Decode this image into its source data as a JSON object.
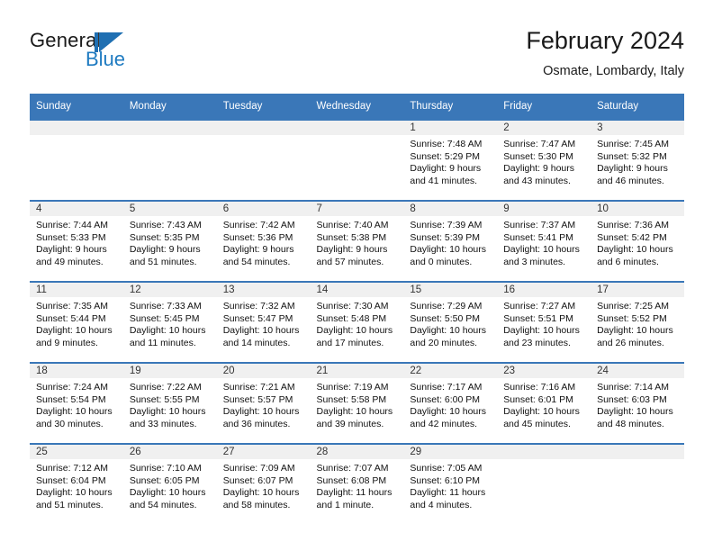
{
  "brand": {
    "name_part1": "General",
    "name_part2": "Blue",
    "mark_icon": "triangle-logo-icon"
  },
  "header": {
    "month_title": "February 2024",
    "location": "Osmate, Lombardy, Italy"
  },
  "theme": {
    "header_blue": "#3a77b8",
    "daynum_band": "#f0f0f0",
    "brand_blue": "#1f7bc1",
    "text": "#111111"
  },
  "weekday_headers": [
    "Sunday",
    "Monday",
    "Tuesday",
    "Wednesday",
    "Thursday",
    "Friday",
    "Saturday"
  ],
  "weeks": [
    [
      {
        "day": "",
        "lines": []
      },
      {
        "day": "",
        "lines": []
      },
      {
        "day": "",
        "lines": []
      },
      {
        "day": "",
        "lines": []
      },
      {
        "day": "1",
        "lines": [
          "Sunrise: 7:48 AM",
          "Sunset: 5:29 PM",
          "Daylight: 9 hours",
          "and 41 minutes."
        ]
      },
      {
        "day": "2",
        "lines": [
          "Sunrise: 7:47 AM",
          "Sunset: 5:30 PM",
          "Daylight: 9 hours",
          "and 43 minutes."
        ]
      },
      {
        "day": "3",
        "lines": [
          "Sunrise: 7:45 AM",
          "Sunset: 5:32 PM",
          "Daylight: 9 hours",
          "and 46 minutes."
        ]
      }
    ],
    [
      {
        "day": "4",
        "lines": [
          "Sunrise: 7:44 AM",
          "Sunset: 5:33 PM",
          "Daylight: 9 hours",
          "and 49 minutes."
        ]
      },
      {
        "day": "5",
        "lines": [
          "Sunrise: 7:43 AM",
          "Sunset: 5:35 PM",
          "Daylight: 9 hours",
          "and 51 minutes."
        ]
      },
      {
        "day": "6",
        "lines": [
          "Sunrise: 7:42 AM",
          "Sunset: 5:36 PM",
          "Daylight: 9 hours",
          "and 54 minutes."
        ]
      },
      {
        "day": "7",
        "lines": [
          "Sunrise: 7:40 AM",
          "Sunset: 5:38 PM",
          "Daylight: 9 hours",
          "and 57 minutes."
        ]
      },
      {
        "day": "8",
        "lines": [
          "Sunrise: 7:39 AM",
          "Sunset: 5:39 PM",
          "Daylight: 10 hours",
          "and 0 minutes."
        ]
      },
      {
        "day": "9",
        "lines": [
          "Sunrise: 7:37 AM",
          "Sunset: 5:41 PM",
          "Daylight: 10 hours",
          "and 3 minutes."
        ]
      },
      {
        "day": "10",
        "lines": [
          "Sunrise: 7:36 AM",
          "Sunset: 5:42 PM",
          "Daylight: 10 hours",
          "and 6 minutes."
        ]
      }
    ],
    [
      {
        "day": "11",
        "lines": [
          "Sunrise: 7:35 AM",
          "Sunset: 5:44 PM",
          "Daylight: 10 hours",
          "and 9 minutes."
        ]
      },
      {
        "day": "12",
        "lines": [
          "Sunrise: 7:33 AM",
          "Sunset: 5:45 PM",
          "Daylight: 10 hours",
          "and 11 minutes."
        ]
      },
      {
        "day": "13",
        "lines": [
          "Sunrise: 7:32 AM",
          "Sunset: 5:47 PM",
          "Daylight: 10 hours",
          "and 14 minutes."
        ]
      },
      {
        "day": "14",
        "lines": [
          "Sunrise: 7:30 AM",
          "Sunset: 5:48 PM",
          "Daylight: 10 hours",
          "and 17 minutes."
        ]
      },
      {
        "day": "15",
        "lines": [
          "Sunrise: 7:29 AM",
          "Sunset: 5:50 PM",
          "Daylight: 10 hours",
          "and 20 minutes."
        ]
      },
      {
        "day": "16",
        "lines": [
          "Sunrise: 7:27 AM",
          "Sunset: 5:51 PM",
          "Daylight: 10 hours",
          "and 23 minutes."
        ]
      },
      {
        "day": "17",
        "lines": [
          "Sunrise: 7:25 AM",
          "Sunset: 5:52 PM",
          "Daylight: 10 hours",
          "and 26 minutes."
        ]
      }
    ],
    [
      {
        "day": "18",
        "lines": [
          "Sunrise: 7:24 AM",
          "Sunset: 5:54 PM",
          "Daylight: 10 hours",
          "and 30 minutes."
        ]
      },
      {
        "day": "19",
        "lines": [
          "Sunrise: 7:22 AM",
          "Sunset: 5:55 PM",
          "Daylight: 10 hours",
          "and 33 minutes."
        ]
      },
      {
        "day": "20",
        "lines": [
          "Sunrise: 7:21 AM",
          "Sunset: 5:57 PM",
          "Daylight: 10 hours",
          "and 36 minutes."
        ]
      },
      {
        "day": "21",
        "lines": [
          "Sunrise: 7:19 AM",
          "Sunset: 5:58 PM",
          "Daylight: 10 hours",
          "and 39 minutes."
        ]
      },
      {
        "day": "22",
        "lines": [
          "Sunrise: 7:17 AM",
          "Sunset: 6:00 PM",
          "Daylight: 10 hours",
          "and 42 minutes."
        ]
      },
      {
        "day": "23",
        "lines": [
          "Sunrise: 7:16 AM",
          "Sunset: 6:01 PM",
          "Daylight: 10 hours",
          "and 45 minutes."
        ]
      },
      {
        "day": "24",
        "lines": [
          "Sunrise: 7:14 AM",
          "Sunset: 6:03 PM",
          "Daylight: 10 hours",
          "and 48 minutes."
        ]
      }
    ],
    [
      {
        "day": "25",
        "lines": [
          "Sunrise: 7:12 AM",
          "Sunset: 6:04 PM",
          "Daylight: 10 hours",
          "and 51 minutes."
        ]
      },
      {
        "day": "26",
        "lines": [
          "Sunrise: 7:10 AM",
          "Sunset: 6:05 PM",
          "Daylight: 10 hours",
          "and 54 minutes."
        ]
      },
      {
        "day": "27",
        "lines": [
          "Sunrise: 7:09 AM",
          "Sunset: 6:07 PM",
          "Daylight: 10 hours",
          "and 58 minutes."
        ]
      },
      {
        "day": "28",
        "lines": [
          "Sunrise: 7:07 AM",
          "Sunset: 6:08 PM",
          "Daylight: 11 hours",
          "and 1 minute."
        ]
      },
      {
        "day": "29",
        "lines": [
          "Sunrise: 7:05 AM",
          "Sunset: 6:10 PM",
          "Daylight: 11 hours",
          "and 4 minutes."
        ]
      },
      {
        "day": "",
        "lines": []
      },
      {
        "day": "",
        "lines": []
      }
    ]
  ]
}
